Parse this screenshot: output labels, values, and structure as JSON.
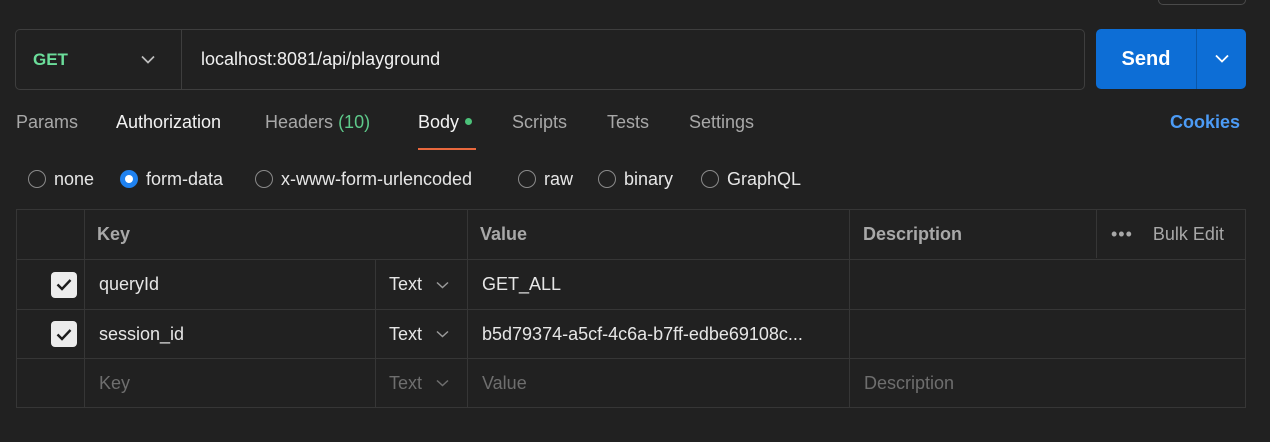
{
  "request": {
    "method": "GET",
    "url": "localhost:8081/api/playground",
    "send_label": "Send"
  },
  "tabs": {
    "params": "Params",
    "authorization": "Authorization",
    "headers": "Headers",
    "headers_count": "(10)",
    "body": "Body",
    "scripts": "Scripts",
    "tests": "Tests",
    "settings": "Settings",
    "cookies": "Cookies"
  },
  "body_types": {
    "none": "none",
    "form_data": "form-data",
    "urlencoded": "x-www-form-urlencoded",
    "raw": "raw",
    "binary": "binary",
    "graphql": "GraphQL",
    "selected": "form-data"
  },
  "table": {
    "headers": {
      "key": "Key",
      "value": "Value",
      "description": "Description",
      "more": "•••",
      "bulk_edit": "Bulk Edit"
    },
    "rows": [
      {
        "checked": true,
        "key": "queryId",
        "type": "Text",
        "value": "GET_ALL",
        "description": ""
      },
      {
        "checked": true,
        "key": "session_id",
        "type": "Text",
        "value": "b5d79374-a5cf-4c6a-b7ff-edbe69108c...",
        "description": ""
      }
    ],
    "placeholder": {
      "key": "Key",
      "type": "Text",
      "value": "Value",
      "description": "Description"
    }
  },
  "colors": {
    "accent": "#0d6ed6",
    "method": "#6bdd9a",
    "active_tab": "#e8683d",
    "cookies": "#4c9bf5"
  },
  "icons": {
    "chevron": "chevron-down-icon",
    "check": "checkmark-icon"
  }
}
